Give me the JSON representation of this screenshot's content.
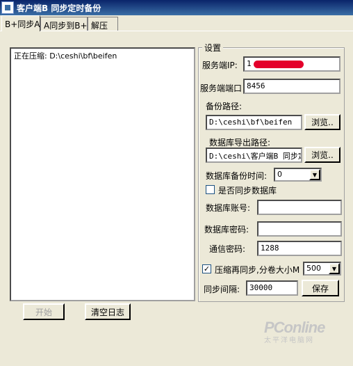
{
  "window": {
    "title": "客户端B 同步定时备份"
  },
  "tabs": [
    {
      "label": "B+同步A"
    },
    {
      "label": "A同步到B+"
    },
    {
      "label": "解压"
    }
  ],
  "log": {
    "text": "正在压缩: D:\\ceshi\\bf\\beifen"
  },
  "settings": {
    "group_title": "设置",
    "server_ip_label": "服务端IP:",
    "server_ip_value": "1",
    "server_port_label": "服务端端口",
    "server_port_value": "8456",
    "backup_path_label": "备份路径:",
    "backup_path_value": "D:\\ceshi\\bf\\beifen",
    "browse_label": "浏览..",
    "db_export_label": "数据库导出路径:",
    "db_export_value": "D:\\ceshi\\客户端B 同步定",
    "browse2_label": "浏览..",
    "db_backup_time_label": "数据库备份时间:",
    "db_backup_time_value": "0",
    "sync_db_label": "是否同步数据库",
    "sync_db_checked": false,
    "db_account_label": "数据库账号:",
    "db_account_value": "",
    "db_password_label": "数据库密码:",
    "db_password_value": "",
    "comm_password_label": "通信密码:",
    "comm_password_value": "1288",
    "compress_label": "压缩再同步,分卷大小M",
    "compress_checked": true,
    "volume_size_value": "500",
    "sync_interval_label": "同步间隔:",
    "sync_interval_value": "30000",
    "save_label": "保存"
  },
  "bottom": {
    "start_label": "开始",
    "clear_log_label": "清空日志"
  },
  "watermark": {
    "logo": "PConline",
    "sub": "太平洋电脑网"
  },
  "colors": {
    "titlebar": "#0a246a",
    "background": "#ece9d8",
    "redaction": "#e4002b"
  }
}
